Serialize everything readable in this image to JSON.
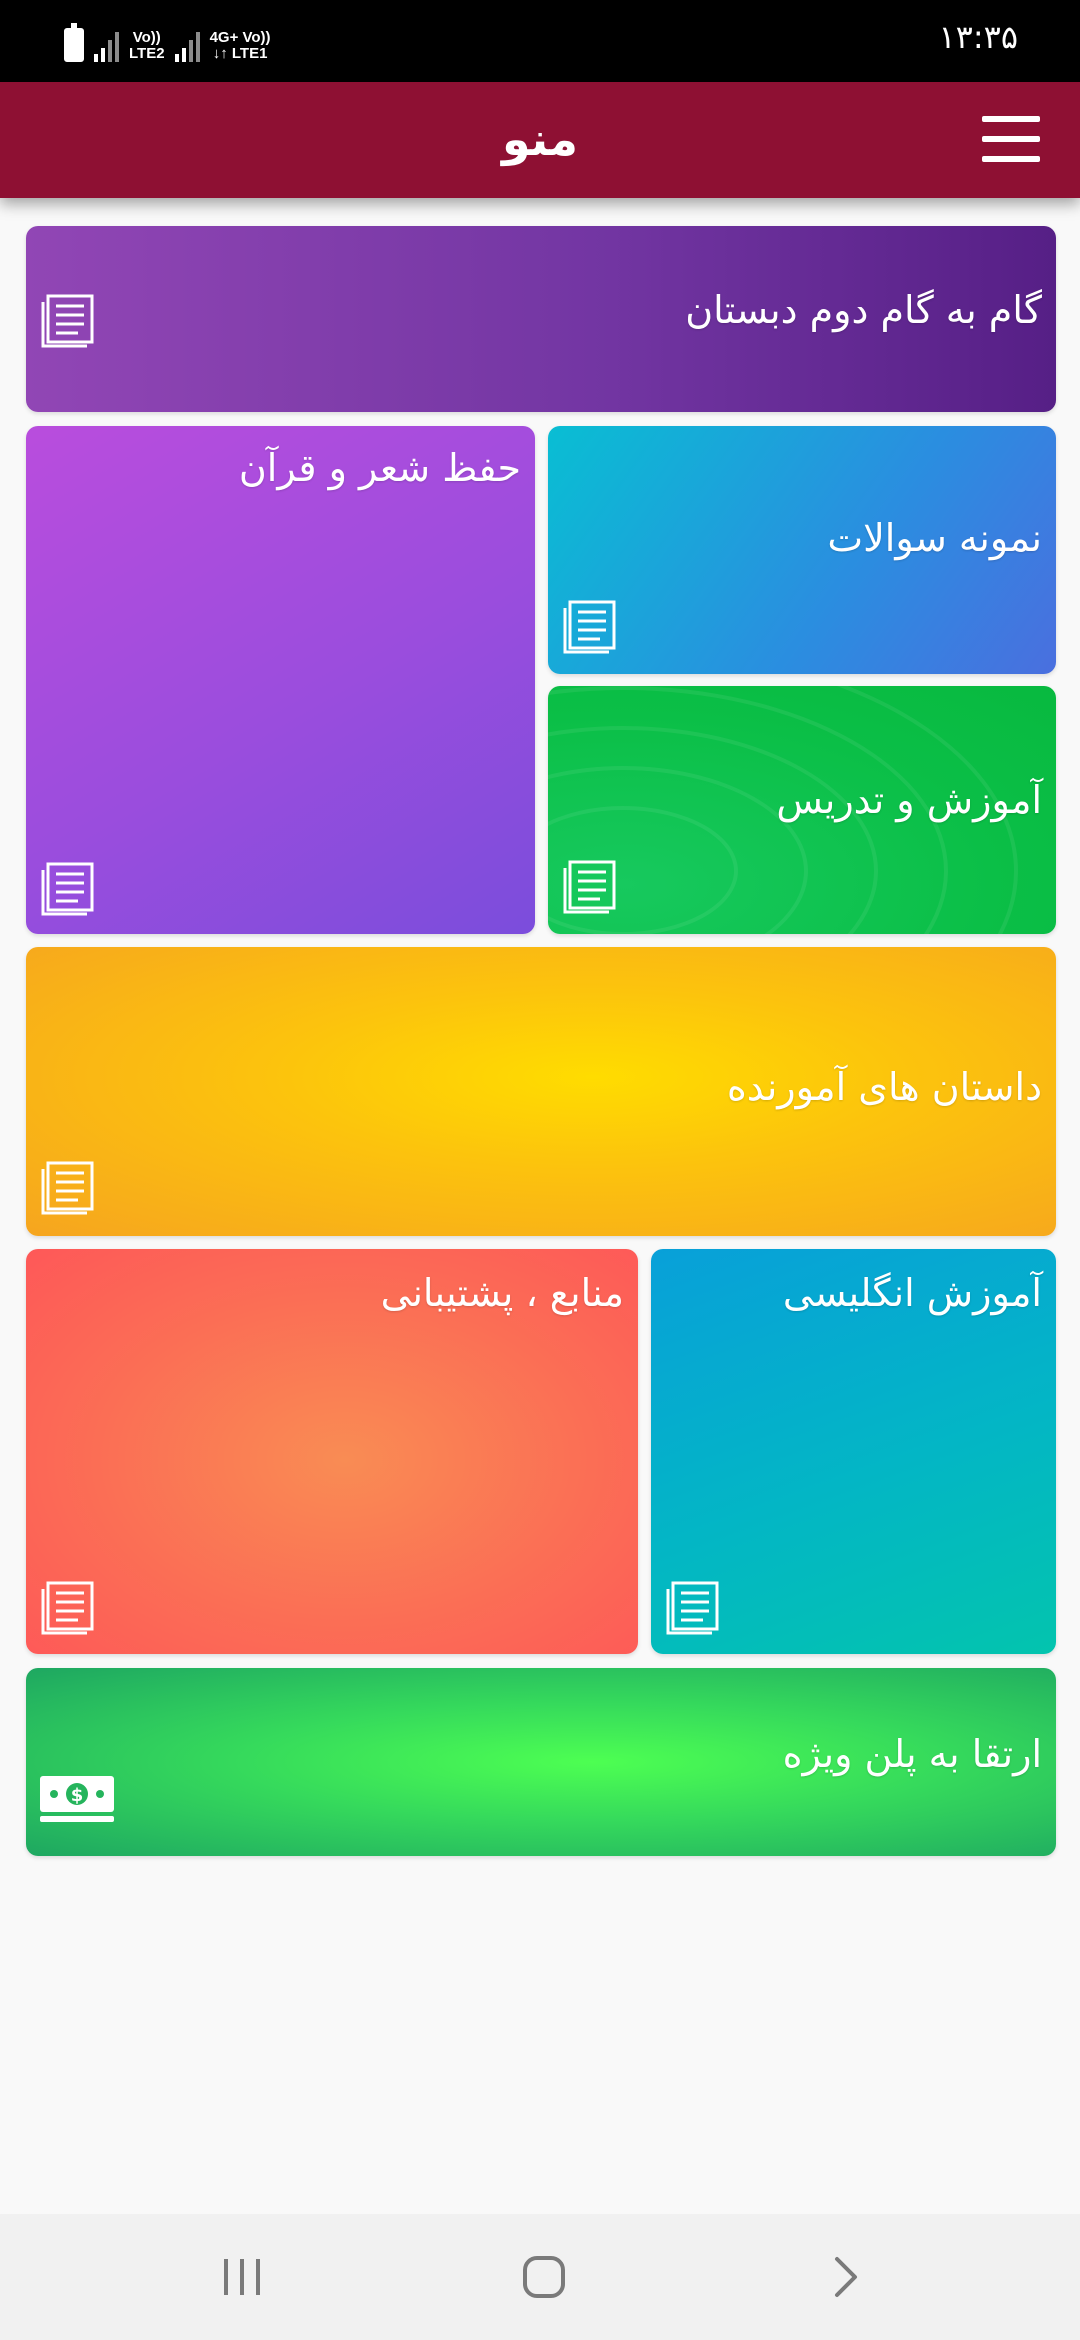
{
  "status_bar": {
    "time": "۱۳:۳۵",
    "sim2_top": "Vo))",
    "sim2_bottom": "LTE2",
    "sim1_top": "4G+ Vo))",
    "sim1_bottom": "↓↑ LTE1"
  },
  "app_bar": {
    "title": "منو",
    "menu_icon": "hamburger-menu-icon"
  },
  "tiles": [
    {
      "label": "گام به گام دوم دبستان",
      "icon": "document-icon"
    },
    {
      "label": "حفظ شعر و قرآن",
      "icon": "document-icon"
    },
    {
      "label": "نمونه سوالات",
      "icon": "document-icon"
    },
    {
      "label": "آموزش و تدریس",
      "icon": "document-icon"
    },
    {
      "label": "داستان های آمورنده",
      "icon": "document-icon"
    },
    {
      "label": "منابع ، پشتیبانی",
      "icon": "document-icon"
    },
    {
      "label": "آموزش انگلیسی",
      "icon": "document-icon"
    },
    {
      "label": "ارتقا به پلن ویژه",
      "icon": "money-bill-icon"
    }
  ],
  "nav": {
    "recents_icon": "recent-apps-icon",
    "home_icon": "home-icon",
    "back_icon": "back-icon"
  },
  "colors": {
    "app_bar": "#8e1033",
    "status_bar": "#000000",
    "background": "#f9f9f9"
  }
}
